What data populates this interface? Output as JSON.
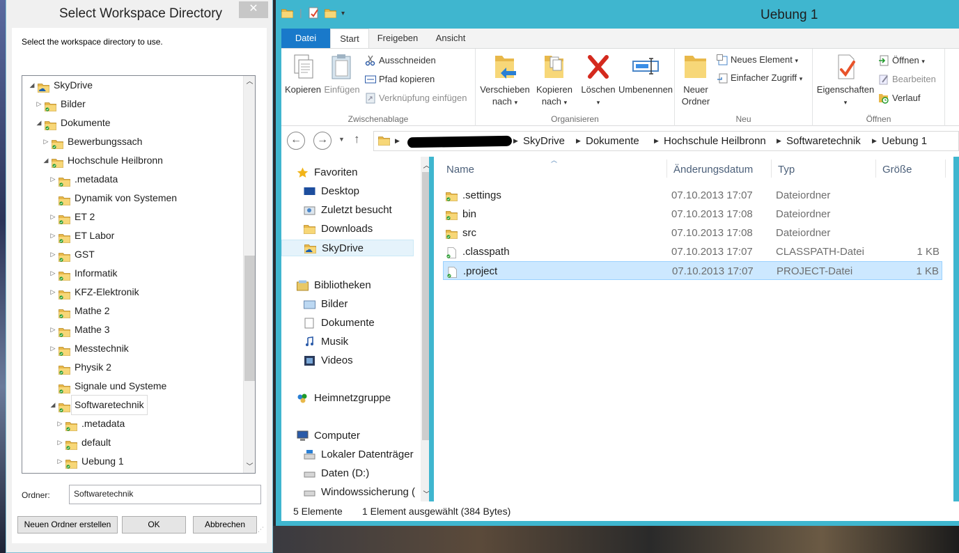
{
  "dialog": {
    "title": "Select Workspace Directory",
    "close_glyph": "✕",
    "instruction": "Select the workspace directory to use.",
    "tree": [
      {
        "label": "SkyDrive",
        "level": 0,
        "expanded": true,
        "icon": "skydrive-folder-icon"
      },
      {
        "label": "Bilder",
        "level": 1,
        "expanded": false,
        "icon": "folder-icon"
      },
      {
        "label": "Dokumente",
        "level": 1,
        "expanded": true,
        "icon": "folder-icon"
      },
      {
        "label": "Bewerbungssach",
        "level": 2,
        "expanded": false,
        "icon": "folder-icon"
      },
      {
        "label": "Hochschule Heilbronn",
        "level": 2,
        "expanded": true,
        "icon": "folder-icon"
      },
      {
        "label": ".metadata",
        "level": 3,
        "expanded": false,
        "icon": "folder-icon"
      },
      {
        "label": "Dynamik von Systemen",
        "level": 3,
        "expanded": null,
        "icon": "folder-icon"
      },
      {
        "label": "ET 2",
        "level": 3,
        "expanded": false,
        "icon": "folder-icon"
      },
      {
        "label": "ET Labor",
        "level": 3,
        "expanded": false,
        "icon": "folder-icon"
      },
      {
        "label": "GST",
        "level": 3,
        "expanded": false,
        "icon": "folder-icon"
      },
      {
        "label": "Informatik",
        "level": 3,
        "expanded": false,
        "icon": "folder-icon"
      },
      {
        "label": "KFZ-Elektronik",
        "level": 3,
        "expanded": false,
        "icon": "folder-icon"
      },
      {
        "label": "Mathe 2",
        "level": 3,
        "expanded": null,
        "icon": "folder-icon"
      },
      {
        "label": "Mathe 3",
        "level": 3,
        "expanded": false,
        "icon": "folder-icon"
      },
      {
        "label": "Messtechnik",
        "level": 3,
        "expanded": false,
        "icon": "folder-icon"
      },
      {
        "label": "Physik 2",
        "level": 3,
        "expanded": null,
        "icon": "folder-icon"
      },
      {
        "label": "Signale und Systeme",
        "level": 3,
        "expanded": null,
        "icon": "folder-icon"
      },
      {
        "label": "Softwaretechnik",
        "level": 3,
        "expanded": true,
        "icon": "folder-icon",
        "selected": true
      },
      {
        "label": ".metadata",
        "level": 4,
        "expanded": false,
        "icon": "folder-icon"
      },
      {
        "label": "default",
        "level": 4,
        "expanded": false,
        "icon": "folder-icon"
      },
      {
        "label": "Uebung 1",
        "level": 4,
        "expanded": false,
        "icon": "folder-icon"
      }
    ],
    "folder_label": "Ordner:",
    "folder_value": "Softwaretechnik",
    "buttons": {
      "new_folder": "Neuen Ordner erstellen",
      "ok": "OK",
      "cancel": "Abbrechen"
    }
  },
  "explorer": {
    "title": "Uebung 1",
    "tabs": [
      "Datei",
      "Start",
      "Freigeben",
      "Ansicht"
    ],
    "active_tab": "Start",
    "ribbon": {
      "clipboard": {
        "group_label": "Zwischenablage",
        "copy": "Kopieren",
        "paste": "Einfügen",
        "cut": "Ausschneiden",
        "copy_path": "Pfad kopieren",
        "paste_shortcut": "Verknüpfung einfügen"
      },
      "organize": {
        "group_label": "Organisieren",
        "move_to_1": "Verschieben",
        "move_to_2": "nach",
        "copy_to_1": "Kopieren",
        "copy_to_2": "nach",
        "delete": "Löschen",
        "rename": "Umbenennen"
      },
      "new": {
        "group_label": "Neu",
        "new_folder_1": "Neuer",
        "new_folder_2": "Ordner",
        "new_item": "Neues Element",
        "easy_access": "Einfacher Zugriff"
      },
      "open": {
        "group_label": "Öffnen",
        "properties": "Eigenschaften",
        "open": "Öffnen",
        "edit": "Bearbeiten",
        "history": "Verlauf"
      }
    },
    "address": {
      "crumbs": [
        "SkyDrive",
        "Dokumente",
        "Hochschule Heilbronn",
        "Softwaretechnik",
        "Uebung 1"
      ]
    },
    "nav": [
      {
        "label": "Favoriten",
        "indent": 0,
        "icon": "star-icon"
      },
      {
        "label": "Desktop",
        "indent": 1,
        "icon": "desktop-icon"
      },
      {
        "label": "Zuletzt besucht",
        "indent": 1,
        "icon": "recent-places-icon"
      },
      {
        "label": "Downloads",
        "indent": 1,
        "icon": "downloads-folder-icon"
      },
      {
        "label": "SkyDrive",
        "indent": 1,
        "icon": "skydrive-folder-icon",
        "selected": true
      },
      {
        "label": "Bibliotheken",
        "indent": 0,
        "icon": "libraries-icon"
      },
      {
        "label": "Bilder",
        "indent": 1,
        "icon": "pictures-library-icon"
      },
      {
        "label": "Dokumente",
        "indent": 1,
        "icon": "documents-library-icon"
      },
      {
        "label": "Musik",
        "indent": 1,
        "icon": "music-library-icon"
      },
      {
        "label": "Videos",
        "indent": 1,
        "icon": "videos-library-icon"
      },
      {
        "label": "Heimnetzgruppe",
        "indent": 0,
        "icon": "homegroup-icon"
      },
      {
        "label": "Computer",
        "indent": 0,
        "icon": "computer-icon"
      },
      {
        "label": "Lokaler Datenträger",
        "indent": 1,
        "icon": "local-disk-icon"
      },
      {
        "label": "Daten (D:)",
        "indent": 1,
        "icon": "drive-icon"
      },
      {
        "label": "Windowssicherung (",
        "indent": 1,
        "icon": "drive-icon"
      }
    ],
    "columns": {
      "name": "Name",
      "date": "Änderungsdatum",
      "type": "Typ",
      "size": "Größe"
    },
    "files": [
      {
        "name": ".settings",
        "date": "07.10.2013 17:07",
        "type": "Dateiordner",
        "size": "",
        "kind": "folder"
      },
      {
        "name": "bin",
        "date": "07.10.2013 17:08",
        "type": "Dateiordner",
        "size": "",
        "kind": "folder"
      },
      {
        "name": "src",
        "date": "07.10.2013 17:08",
        "type": "Dateiordner",
        "size": "",
        "kind": "folder"
      },
      {
        "name": ".classpath",
        "date": "07.10.2013 17:07",
        "type": "CLASSPATH-Datei",
        "size": "1 KB",
        "kind": "file"
      },
      {
        "name": ".project",
        "date": "07.10.2013 17:07",
        "type": "PROJECT-Datei",
        "size": "1 KB",
        "kind": "file",
        "selected": true
      }
    ],
    "status": {
      "count": "5 Elemente",
      "selection": "1 Element ausgewählt (384 Bytes)"
    }
  }
}
